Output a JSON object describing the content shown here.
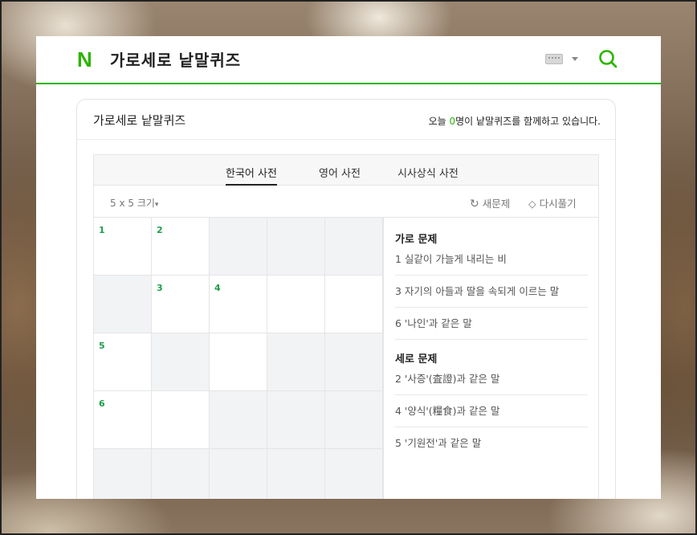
{
  "header": {
    "logo": "N",
    "title": "가로세로 낱말퀴즈"
  },
  "panel": {
    "title": "가로세로 낱말퀴즈",
    "status_prefix": "오늘 ",
    "status_count": "0",
    "status_suffix": "명이 낱말퀴즈를 함께하고 있습니다."
  },
  "tabs": [
    {
      "label": "한국어 사전",
      "active": true
    },
    {
      "label": "영어 사전",
      "active": false
    },
    {
      "label": "시사상식 사전",
      "active": false
    }
  ],
  "toolbar": {
    "size": "5 x 5 크기",
    "new_label": "새문제",
    "reset_label": "다시풀기"
  },
  "grid": {
    "rows": [
      [
        {
          "n": "1",
          "b": false
        },
        {
          "n": "2",
          "b": false
        },
        {
          "n": "",
          "b": true
        },
        {
          "n": "",
          "b": true
        },
        {
          "n": "",
          "b": true
        }
      ],
      [
        {
          "n": "",
          "b": true
        },
        {
          "n": "3",
          "b": false
        },
        {
          "n": "4",
          "b": false
        },
        {
          "n": "",
          "b": false
        },
        {
          "n": "",
          "b": false
        }
      ],
      [
        {
          "n": "5",
          "b": false
        },
        {
          "n": "",
          "b": true
        },
        {
          "n": "",
          "b": false
        },
        {
          "n": "",
          "b": true
        },
        {
          "n": "",
          "b": true
        }
      ],
      [
        {
          "n": "6",
          "b": false
        },
        {
          "n": "",
          "b": false
        },
        {
          "n": "",
          "b": true
        },
        {
          "n": "",
          "b": true
        },
        {
          "n": "",
          "b": true
        }
      ],
      [
        {
          "n": "",
          "b": true
        },
        {
          "n": "",
          "b": true
        },
        {
          "n": "",
          "b": true
        },
        {
          "n": "",
          "b": true
        },
        {
          "n": "",
          "b": true
        }
      ]
    ]
  },
  "clues": {
    "across_title": "가로 문제",
    "across": [
      "1 실같이 가늘게 내리는 비",
      "3 자기의 아들과 딸을 속되게 이르는 말",
      "6 '나인'과 같은 말"
    ],
    "down_title": "세로 문제",
    "down": [
      "2 '사증'(査證)과 같은 말",
      "4 '양식'(糧食)과 같은 말",
      "5 '기원전'과 같은 말"
    ]
  },
  "colors": {
    "accent": "#2db400",
    "cell_number": "#1e9f4b",
    "blocked_cell": "#f2f3f5"
  }
}
